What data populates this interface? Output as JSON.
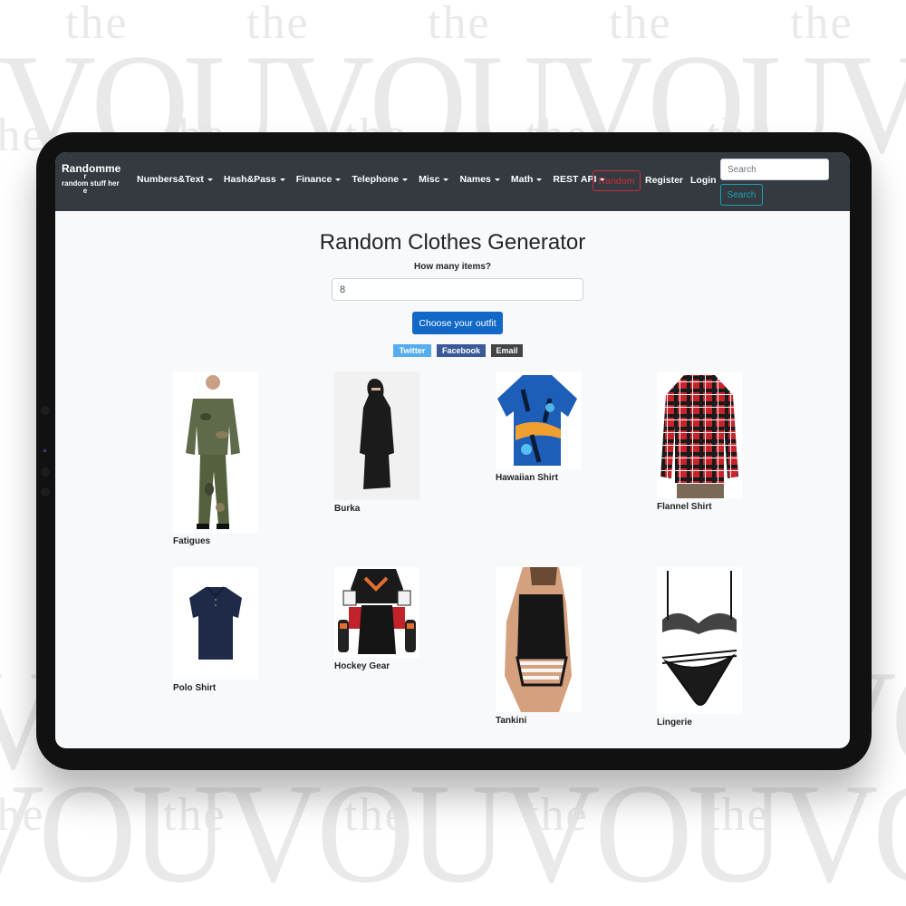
{
  "watermark": {
    "small_word": "the",
    "large_word": "VOUVOUVOUVOUVOUVOU"
  },
  "navbar": {
    "brand_title": "Randomme",
    "brand_title_wrap": "r",
    "brand_subtitle": "random stuff her",
    "brand_subtitle_wrap": "e",
    "menus": [
      {
        "label": "Numbers&Text"
      },
      {
        "label": "Hash&Pass"
      },
      {
        "label": "Finance"
      },
      {
        "label": "Telephone"
      },
      {
        "label": "Misc"
      },
      {
        "label": "Names"
      },
      {
        "label": "Math"
      },
      {
        "label": "REST API"
      }
    ],
    "random_label": "Random",
    "register_label": "Register",
    "login_label": "Login",
    "search_placeholder": "Search",
    "search_button_label": "Search"
  },
  "main": {
    "title": "Random Clothes Generator",
    "count_label": "How many items?",
    "count_value": "8",
    "submit_label": "Choose your outfit",
    "share": {
      "twitter": "Twitter",
      "facebook": "Facebook",
      "email": "Email"
    },
    "items": [
      {
        "name": "Fatigues"
      },
      {
        "name": "Burka"
      },
      {
        "name": "Hawaiian Shirt"
      },
      {
        "name": "Flannel Shirt"
      },
      {
        "name": "Polo Shirt"
      },
      {
        "name": "Hockey Gear"
      },
      {
        "name": "Tankini"
      },
      {
        "name": "Lingerie"
      }
    ]
  },
  "colors": {
    "navbar_bg": "#343a40",
    "primary": "#1168c6",
    "danger": "#c9303e",
    "info": "#17a2b8",
    "twitter": "#55acee",
    "facebook": "#3b5998",
    "email": "#444444"
  }
}
